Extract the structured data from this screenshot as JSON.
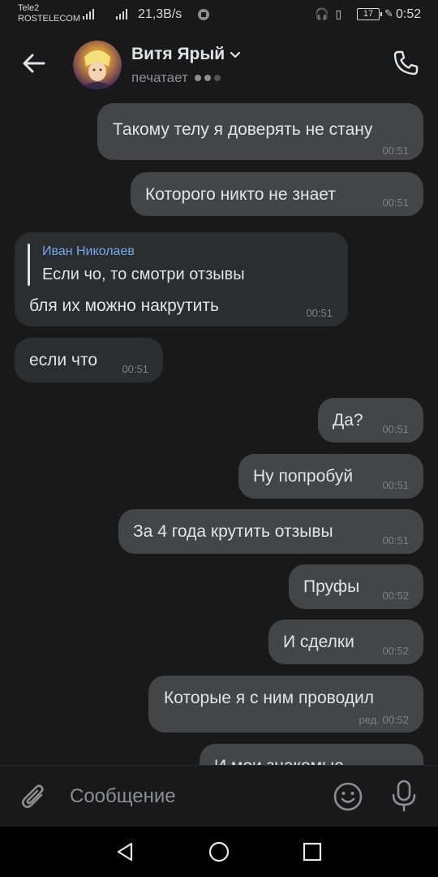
{
  "status_bar": {
    "carrier_1": "Tele2",
    "carrier_2": "ROSTELECOM",
    "net_speed": "21,3B/s",
    "battery": "17",
    "time": "0:52"
  },
  "header": {
    "name": "Витя Ярый",
    "status": "печатает"
  },
  "messages": [
    {
      "dir": "out",
      "text": "Такому телу я доверять не стану",
      "time": "00:51"
    },
    {
      "dir": "out",
      "text": "Которого никто не знает",
      "time": "00:51"
    },
    {
      "dir": "in",
      "reply_author": "Иван Николаев",
      "reply_text": "Если чо, то смотри отзывы",
      "text": "бля их можно накрутить",
      "time": "00:51"
    },
    {
      "dir": "in",
      "text": "если что",
      "time": "00:51"
    },
    {
      "dir": "out",
      "text": "Да?",
      "time": "00:51"
    },
    {
      "dir": "out",
      "text": "Ну попробуй",
      "time": "00:51"
    },
    {
      "dir": "out",
      "text": "За 4 года крутить отзывы",
      "time": "00:51"
    },
    {
      "dir": "out",
      "text": "Пруфы",
      "time": "00:52"
    },
    {
      "dir": "out",
      "text": "И сделки",
      "time": "00:52"
    },
    {
      "dir": "out",
      "text": "Которые я с ним проводил",
      "time": "ред. 00:52"
    },
    {
      "dir": "out",
      "text": "И мои знакомые",
      "time": ""
    }
  ],
  "composer": {
    "placeholder": "Сообщение"
  },
  "colors": {
    "background": "#19191a",
    "bubble_out": "#444547",
    "bubble_in": "#2c2d2e",
    "reply_author": "#71aaeb",
    "secondary_text": "#8d8e91"
  },
  "icons": {
    "back": "arrow-left-icon",
    "call": "phone-icon",
    "name_dropdown": "chevron-down-icon",
    "attach": "paperclip-icon",
    "emoji": "smile-icon",
    "voice": "microphone-icon",
    "nav_back": "triangle-back-icon",
    "nav_home": "circle-home-icon",
    "nav_recents": "square-recents-icon"
  }
}
